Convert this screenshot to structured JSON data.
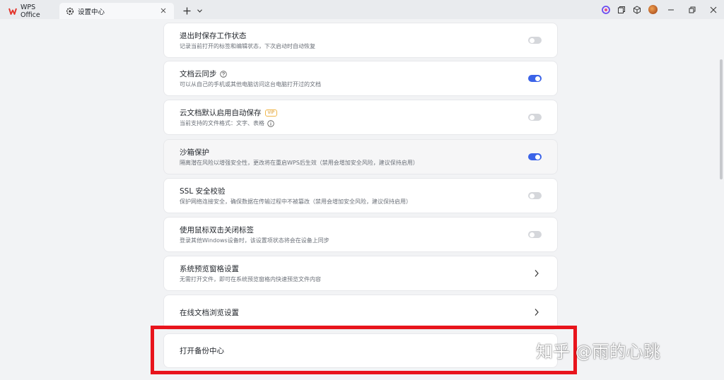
{
  "titlebar": {
    "tabs": [
      {
        "label": "WPS Office",
        "icon": "wps-logo-icon"
      },
      {
        "label": "设置中心",
        "icon": "gear-icon",
        "active": true
      }
    ]
  },
  "settings": [
    {
      "title": "退出时保存工作状态",
      "desc": "记录当前打开的标签和编辑状态，下次启动时自动恢复",
      "control": "toggle",
      "on": false
    },
    {
      "title": "文档云同步",
      "desc": "可以从自己的手机或其他电脑访问这台电脑打开过的文档",
      "control": "toggle",
      "on": true,
      "help_icon": true
    },
    {
      "title": "云文档默认启用自动保存",
      "badge": "VIP",
      "desc": "当前支持的文件格式：文字、表格",
      "control": "toggle",
      "on": false,
      "info_icon": true
    },
    {
      "title": "沙箱保护",
      "desc": "隔离潜在风险以增强安全性，更改将在重启WPS后生效（禁用会增加安全风险，建议保持启用）",
      "control": "toggle",
      "on": true
    },
    {
      "title": "SSL 安全校验",
      "desc": "保护网络连接安全，确保数据在传输过程中不被篡改（禁用会增加安全风险，建议保持启用）",
      "control": "toggle",
      "on": false
    },
    {
      "title": "使用鼠标双击关闭标签",
      "desc": "登录其他Windows设备时，该设置项状态将会在设备上同步",
      "control": "toggle",
      "on": false
    },
    {
      "title": "系统预览窗格设置",
      "desc": "无需打开文件，即可在系统预览窗格内快速预览文件内容",
      "control": "chevron"
    },
    {
      "title": "在线文档浏览设置",
      "control": "chevron"
    },
    {
      "title": "打开备份中心",
      "control": "none"
    }
  ],
  "watermark": "知乎 @雨的心跳",
  "colors": {
    "accent": "#3b63e8",
    "annotation": "#e8141c"
  }
}
